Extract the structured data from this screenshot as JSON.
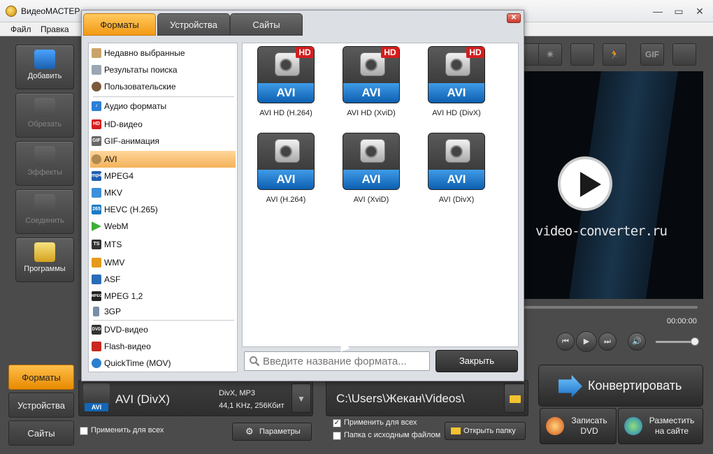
{
  "app": {
    "title": "ВидеоМАСТЕР"
  },
  "menu": {
    "items": [
      "Файл",
      "Правка"
    ]
  },
  "window_controls": {
    "minimize": "—",
    "maximize": "▭",
    "close": "✕"
  },
  "sidebar": {
    "items": [
      {
        "label": "Добавить",
        "icon": "film-add-icon",
        "enabled": true
      },
      {
        "label": "Обрезать",
        "icon": "scissors-icon",
        "enabled": false
      },
      {
        "label": "Эффекты",
        "icon": "effects-icon",
        "enabled": false
      },
      {
        "label": "Соединить",
        "icon": "join-icon",
        "enabled": false
      },
      {
        "label": "Программы",
        "icon": "programs-icon",
        "enabled": true
      }
    ],
    "bottom_tabs": [
      {
        "label": "Форматы",
        "active": true
      },
      {
        "label": "Устройства",
        "active": false
      },
      {
        "label": "Сайты",
        "active": false
      }
    ]
  },
  "dialog": {
    "tabs": [
      {
        "label": "Форматы",
        "active": true
      },
      {
        "label": "Устройства",
        "active": false
      },
      {
        "label": "Сайты",
        "active": false
      }
    ],
    "categories": [
      {
        "label": "Недавно выбранные",
        "icon": "recent-icon"
      },
      {
        "label": "Результаты поиска",
        "icon": "search-results-icon"
      },
      {
        "label": "Пользовательские",
        "icon": "user-icon"
      },
      {
        "label": "Аудио форматы",
        "icon": "music-note-icon"
      },
      {
        "label": "HD-видео",
        "icon": "hd-icon",
        "badge": "HD"
      },
      {
        "label": "GIF-анимация",
        "icon": "gif-icon",
        "badge": "GIF"
      },
      {
        "label": "AVI",
        "icon": "avi-icon",
        "selected": true
      },
      {
        "label": "MPEG4",
        "icon": "mpeg4-icon",
        "badge": "mp4"
      },
      {
        "label": "MKV",
        "icon": "mkv-icon"
      },
      {
        "label": "HEVC (H.265)",
        "icon": "hevc-icon",
        "badge": "265"
      },
      {
        "label": "WebM",
        "icon": "webm-icon"
      },
      {
        "label": "MTS",
        "icon": "mts-icon",
        "badge": "TS"
      },
      {
        "label": "WMV",
        "icon": "wmv-icon"
      },
      {
        "label": "ASF",
        "icon": "asf-icon"
      },
      {
        "label": "MPEG 1,2",
        "icon": "mpeg12-icon",
        "badge": "MPEG"
      },
      {
        "label": "3GP",
        "icon": "phone-icon"
      },
      {
        "label": "DVD-видео",
        "icon": "dvd-icon",
        "badge": "DVD"
      },
      {
        "label": "Flash-видео",
        "icon": "flash-icon"
      },
      {
        "label": "QuickTime (MOV)",
        "icon": "quicktime-icon"
      }
    ],
    "formats": [
      {
        "label": "AVI HD (H.264)",
        "badge": "AVI",
        "hd": "HD"
      },
      {
        "label": "AVI HD (XviD)",
        "badge": "AVI",
        "hd": "HD"
      },
      {
        "label": "AVI HD (DivX)",
        "badge": "AVI",
        "hd": "HD"
      },
      {
        "label": "AVI (H.264)",
        "badge": "AVI",
        "hd": ""
      },
      {
        "label": "AVI (XviD)",
        "badge": "AVI",
        "hd": ""
      },
      {
        "label": "AVI (DivX)",
        "badge": "AVI",
        "hd": ""
      }
    ],
    "search_placeholder": "Введите название формата...",
    "close_label": "Закрыть",
    "close_x": "✕"
  },
  "toolbar": {
    "gif_label": "GIF"
  },
  "player": {
    "watermark": "video-converter.ru",
    "time": "00:00:00",
    "controls": [
      "⏮",
      "▶",
      "⏭",
      "🔊"
    ],
    "volume": 0.9
  },
  "output": {
    "format_name": "AVI (DivX)",
    "format_badge": "AVI",
    "info_line1": "DivX, MP3",
    "info_line2": "44,1 KHz, 256Кбит",
    "apply_all_label": "Применить для всех",
    "params_label": "Параметры",
    "path": "C:\\Users\\Жекан\\Videos\\",
    "path_apply_all_label": "Применить для всех",
    "path_apply_all_checked": true,
    "source_folder_label": "Папка с исходным файлом",
    "open_folder_label": "Открыть папку"
  },
  "actions": {
    "convert_label": "Конвертировать",
    "dvd_label": "Записать DVD",
    "site_label": "Разместить на сайте"
  },
  "colors": {
    "accent": "#f39a14",
    "selected_row": "#f4b25a",
    "avi_blue": "#1466b8",
    "hd_red": "#d41e1e"
  }
}
